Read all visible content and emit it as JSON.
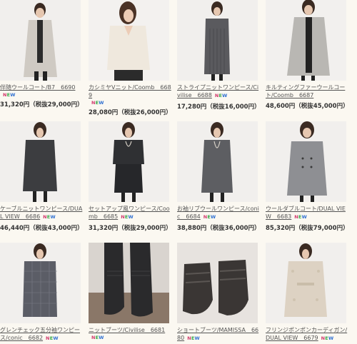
{
  "products": [
    {
      "title": "伴随ウールコート/B7　6690",
      "new": true,
      "price": "31,320円（税抜29,000円）",
      "photo": "light-gray-long-coat"
    },
    {
      "title": "カシミヤVニット/Coomb　6689",
      "new": true,
      "price": "28,080円（税抜26,000円）",
      "photo": "cream-v-neck-knit"
    },
    {
      "title": "ストライプニットワンピース/Civilise　6688",
      "new": true,
      "price": "17,280円（税抜16,000円）",
      "photo": "gray-striped-knit-dress"
    },
    {
      "title": "キルティングファーウールコート/Coomb　6687",
      "new": false,
      "price": "48,600円（税抜45,000円）",
      "photo": "gray-fur-wool-coat"
    },
    {
      "title": "ケーブルニットワンピース/DUAL VIEW　6686",
      "new": true,
      "price": "46,440円（税抜43,000円）",
      "photo": "charcoal-cable-knit-dress"
    },
    {
      "title": "セットアップ風ワンピース/Coomb　6685",
      "new": true,
      "price": "31,320円（税抜29,000円）",
      "photo": "dark-setup-dress"
    },
    {
      "title": "お袖リブウールワンピース/conic　6684",
      "new": true,
      "price": "38,880円（税抜36,000円）",
      "photo": "gray-rib-wool-dress"
    },
    {
      "title": "ウールダブルコート/DUAL VIEW　6683",
      "new": true,
      "price": "85,320円（税抜79,000円）",
      "photo": "gray-double-coat"
    },
    {
      "title": "グレンチェック五分袖ワンピース/conic　6682",
      "new": true,
      "price": "",
      "photo": "glen-check-dress"
    },
    {
      "title": "ニットブーツ/Civilise　6681",
      "new": true,
      "price": "",
      "photo": "knit-boots"
    },
    {
      "title": "ショートブーツ/MAMISSA　6680",
      "new": true,
      "price": "",
      "photo": "short-boots"
    },
    {
      "title": "フリンジポンポンカーディガン/DUAL VIEW　6679",
      "new": true,
      "price": "",
      "photo": "fringe-cardigan"
    }
  ],
  "new_badge": {
    "n": "N",
    "e": "E",
    "w": "W"
  },
  "colors": {
    "badge_n": "#d13a6c",
    "badge_e": "#3aa84a",
    "badge_w": "#2e6fd1"
  }
}
